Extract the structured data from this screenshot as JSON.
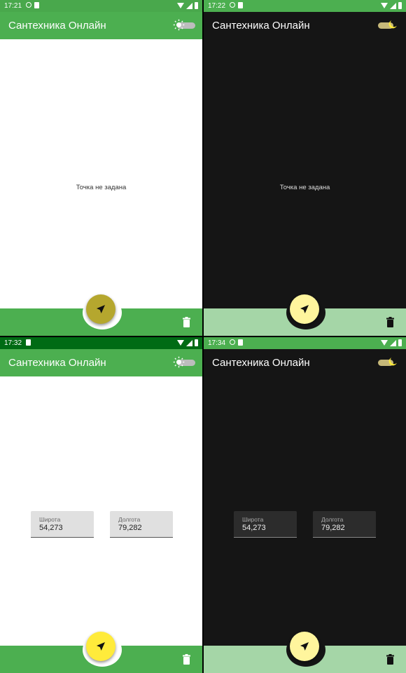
{
  "colors": {
    "green_primary": "#4caf50",
    "status_light": "#49a84c",
    "status_dark_variant": "#006b14",
    "bar_light": "#4caf50",
    "bar_dark": "#a5d6a7",
    "fab_olive": "#b5a72e",
    "fab_yellow": "#ffeb3b",
    "fab_pale": "#fff59d",
    "surface_dark": "#151515",
    "field_light": "#e0e0e0",
    "field_dark": "#2c2c2c"
  },
  "screens": [
    {
      "theme": "light",
      "status": {
        "time": "17:21"
      },
      "appbar": {
        "title": "Сантехника Онлайн",
        "toggle_icon": "sun-icon"
      },
      "content": {
        "message": "Точка не задана"
      },
      "fab_icon": "navigation-arrow-icon",
      "bottom_icon": "trash-icon"
    },
    {
      "theme": "dark",
      "status": {
        "time": "17:22"
      },
      "appbar": {
        "title": "Сантехника Онлайн",
        "toggle_icon": "moon-icon"
      },
      "content": {
        "message": "Точка не задана"
      },
      "fab_icon": "navigation-arrow-icon",
      "bottom_icon": "trash-icon"
    },
    {
      "theme": "light",
      "status": {
        "time": "17:32"
      },
      "appbar": {
        "title": "Сантехника Онлайн",
        "toggle_icon": "sun-icon"
      },
      "content": {
        "latitude": {
          "label": "Широта",
          "value": "54,273"
        },
        "longitude": {
          "label": "Долгота",
          "value": "79,282"
        }
      },
      "fab_icon": "navigation-arrow-icon",
      "bottom_icon": "trash-icon"
    },
    {
      "theme": "dark",
      "status": {
        "time": "17:34"
      },
      "appbar": {
        "title": "Сантехника Онлайн",
        "toggle_icon": "moon-icon"
      },
      "content": {
        "latitude": {
          "label": "Широта",
          "value": "54,273"
        },
        "longitude": {
          "label": "Долгота",
          "value": "79,282"
        }
      },
      "fab_icon": "navigation-arrow-icon",
      "bottom_icon": "trash-icon"
    }
  ]
}
